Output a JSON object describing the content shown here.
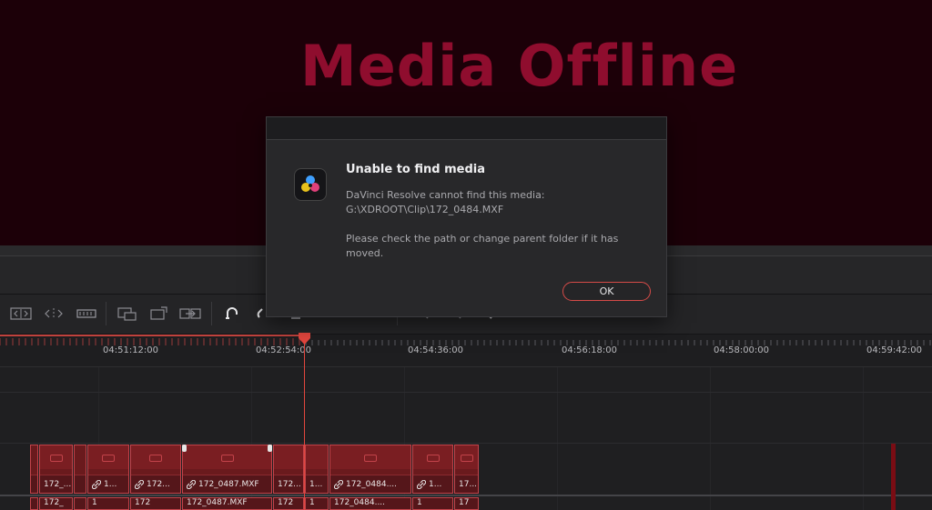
{
  "viewer": {
    "title": "Media Offline"
  },
  "dialog": {
    "heading": "Unable to find media",
    "message_line1": "DaVinci Resolve cannot find this media:",
    "path": "G:\\XDROOT\\Clip\\172_0484.MXF",
    "message_line3": "Please check the path or change parent folder if it has",
    "message_line4": "moved.",
    "ok_label": "OK",
    "logo_icon": "davinci-resolve-logo"
  },
  "ruler": {
    "timecodes": [
      "04:51:12:00",
      "04:52:54:00",
      "04:54:36:00",
      "04:56:18:00",
      "04:58:00:00",
      "04:59:42:00"
    ]
  },
  "toolbar": {
    "icons": [
      "trim-edit-icon",
      "dynamic-trim-icon",
      "blade-icon",
      "insert-clip-icon",
      "overwrite-clip-icon",
      "replace-clip-icon",
      "snapping-icon",
      "linked-selection-icon",
      "flag-icon",
      "zoom-out-icon",
      "zoom-in-icon",
      "zoom-full-icon"
    ]
  },
  "timeline": {
    "video_clips": [
      {
        "name": ""
      },
      {
        "name": "172_..."
      },
      {
        "name": ""
      },
      {
        "name": "1..."
      },
      {
        "name": "172..."
      },
      {
        "name": "172_0487.MXF"
      },
      {
        "name": "172..."
      },
      {
        "name": "1..."
      },
      {
        "name": "172_0484...."
      },
      {
        "name": "1..."
      },
      {
        "name": "17..."
      }
    ],
    "audio_clips": [
      {
        "name": ""
      },
      {
        "name": "172_"
      },
      {
        "name": ""
      },
      {
        "name": "1"
      },
      {
        "name": "172"
      },
      {
        "name": "172_0487.MXF"
      },
      {
        "name": "172"
      },
      {
        "name": "1"
      },
      {
        "name": "172_0484...."
      },
      {
        "name": "1"
      },
      {
        "name": "17"
      }
    ]
  },
  "colors": {
    "accent": "#e2463e",
    "clip_fill": "#6a1a1d",
    "offline_text": "#8f0d2e"
  }
}
